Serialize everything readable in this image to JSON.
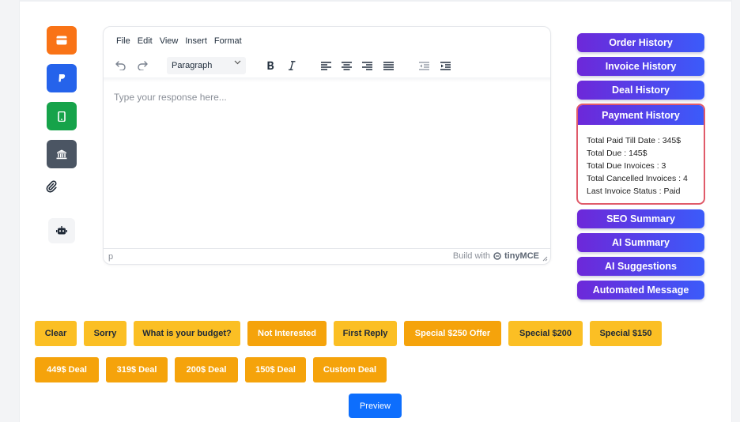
{
  "theme": {
    "accent_orange": "#f97316",
    "accent_blue": "#2563eb",
    "accent_green": "#16a34a",
    "accent_slate": "#4b5563",
    "history_gradient": [
      "#6d28d9",
      "#3b5bfa"
    ],
    "quick_light": "#fbbf24",
    "quick_dark": "#f5a30b",
    "preview_blue": "#0d6efd",
    "payment_border": "#e05b6a"
  },
  "side_icons": [
    {
      "name": "card-icon",
      "color": "#f97316"
    },
    {
      "name": "paypal-icon",
      "color": "#2563eb"
    },
    {
      "name": "mobile-icon",
      "color": "#16a34a"
    },
    {
      "name": "bank-icon",
      "color": "#4b5563"
    },
    {
      "name": "paperclip-icon"
    },
    {
      "name": "robot-icon"
    }
  ],
  "editor": {
    "menu": [
      "File",
      "Edit",
      "View",
      "Insert",
      "Format"
    ],
    "block_format": "Paragraph",
    "placeholder": "Type your response here...",
    "status_path": "p",
    "brand_prefix": "Build with",
    "brand_name": "tinyMCE",
    "toolbar_icons": [
      "undo-icon",
      "redo-icon",
      "bold-icon",
      "italic-icon",
      "align-left-icon",
      "align-center-icon",
      "align-right-icon",
      "align-justify-icon",
      "outdent-icon",
      "indent-icon"
    ]
  },
  "history": {
    "order": "Order History",
    "invoice": "Invoice History",
    "deal": "Deal History",
    "payment": "Payment History",
    "payment_lines": [
      "Total Paid Till Date : 345$",
      "Total Due : 145$",
      "Total Due Invoices : 3",
      "Total Cancelled Invoices : 4",
      "Last Invoice Status : Paid"
    ],
    "seo": "SEO Summary",
    "ai_summary": "AI Summary",
    "ai_suggestions": "AI Suggestions",
    "automated": "Automated Message"
  },
  "quick_replies": {
    "row1": [
      "Clear",
      "Sorry",
      "What is your budget?",
      "Not Interested",
      "First Reply",
      "Special $250 Offer",
      "Special $200",
      "Special $150"
    ],
    "row2": [
      "449$ Deal",
      "319$ Deal",
      "200$ Deal",
      "150$ Deal",
      "Custom Deal"
    ]
  },
  "preview_label": "Preview"
}
